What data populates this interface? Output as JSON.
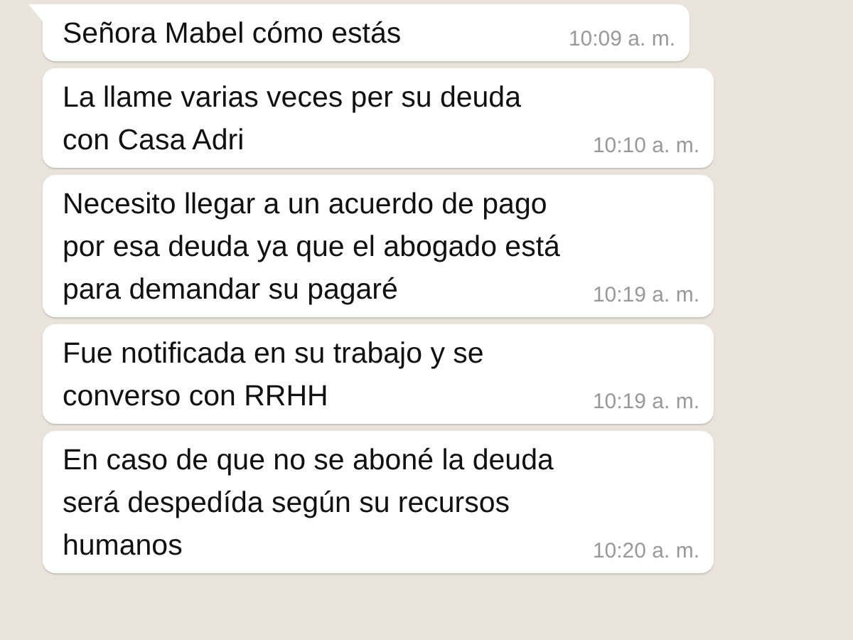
{
  "messages": [
    {
      "lines": [
        "Señora Mabel cómo estás"
      ],
      "time": "10:09 a. m.",
      "tail": true
    },
    {
      "lines": [
        "La llame varias veces per su deuda",
        "con Casa Adri"
      ],
      "time": "10:10 a. m.",
      "tail": false
    },
    {
      "lines": [
        "Necesito llegar a un acuerdo de pago",
        "por esa deuda ya que el abogado está",
        "para demandar su pagaré"
      ],
      "time": "10:19 a. m.",
      "tail": false
    },
    {
      "lines": [
        "Fue notificada en su trabajo y se",
        "converso con RRHH"
      ],
      "time": "10:19 a. m.",
      "tail": false
    },
    {
      "lines": [
        "En caso de que no se aboné la deuda",
        "será despedída según su recursos",
        "humanos"
      ],
      "time": "10:20 a. m.",
      "tail": false
    }
  ]
}
